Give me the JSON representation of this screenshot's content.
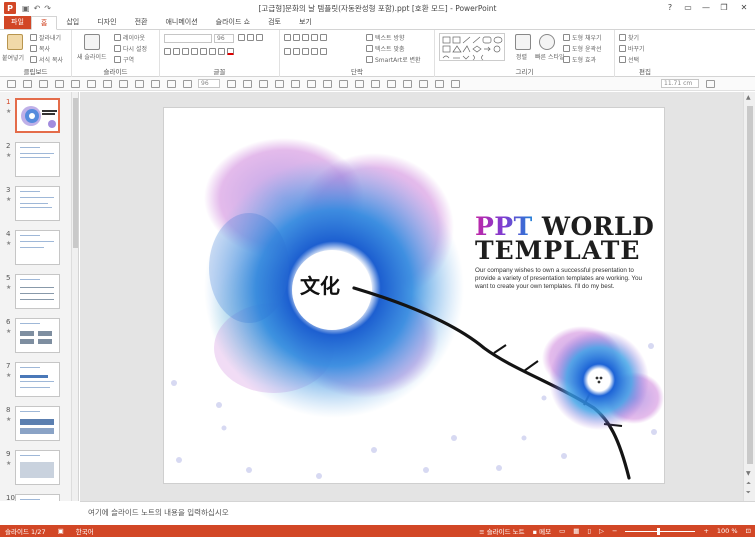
{
  "window": {
    "title": "[고급형]문화의 날 템플릿(자동완성형 포함).ppt [호환 모드] - PowerPoint",
    "app_icon_letter": "P",
    "controls": [
      "?",
      "▭",
      "—",
      "❐",
      "✕"
    ]
  },
  "tabs": [
    {
      "label": "파일"
    },
    {
      "label": "홈"
    },
    {
      "label": "삽입"
    },
    {
      "label": "디자인"
    },
    {
      "label": "전환"
    },
    {
      "label": "애니메이션"
    },
    {
      "label": "슬라이드 쇼"
    },
    {
      "label": "검토"
    },
    {
      "label": "보기"
    }
  ],
  "ribbon": {
    "clipboard": {
      "label": "클립보드",
      "paste": "붙여넣기",
      "cut": "잘라내기",
      "copy": "복사",
      "format_painter": "서식 복사"
    },
    "slides": {
      "label": "슬라이드",
      "new_slide": "새 슬라이드",
      "layout": "레이아웃",
      "reset": "다시 설정",
      "section": "구역"
    },
    "font": {
      "label": "글꼴",
      "size": "96"
    },
    "paragraph": {
      "label": "단락",
      "text_direction": "텍스트 방향",
      "align_text": "텍스트 맞춤",
      "smartart": "SmartArt로 변환"
    },
    "drawing": {
      "label": "그리기",
      "arrange": "정렬",
      "quick_styles": "빠른 스타일",
      "shape_fill": "도형 채우기",
      "shape_outline": "도형 윤곽선",
      "shape_effects": "도형 효과"
    },
    "editing": {
      "label": "편집",
      "find": "찾기",
      "replace": "바꾸기",
      "select": "선택"
    }
  },
  "quick_toolbar": {
    "font_size": "96",
    "measure": "11.71 cm"
  },
  "thumbnails": [
    {
      "num": "1",
      "star": "★",
      "active": true
    },
    {
      "num": "2",
      "star": "★"
    },
    {
      "num": "3",
      "star": "★"
    },
    {
      "num": "4",
      "star": "★"
    },
    {
      "num": "5",
      "star": "★"
    },
    {
      "num": "6",
      "star": "★"
    },
    {
      "num": "7",
      "star": "★"
    },
    {
      "num": "8",
      "star": "★"
    },
    {
      "num": "9",
      "star": "★"
    },
    {
      "num": "10",
      "star": "★"
    }
  ],
  "slide": {
    "title_ppt": "PPT",
    "title_world": " WORLD",
    "title_line2": "TEMPLATE",
    "body": "Our company wishes to own a successful presentation to provide a variety of presentation templates are working. You want to create your own templates. I'll do my best.",
    "culture_chars": "文化"
  },
  "notes": {
    "placeholder": "여기에 슬라이드 노트의 내용을 입력하십시오"
  },
  "status": {
    "slide_count": "슬라이드 1/27",
    "language": "한국어",
    "notes_btn": "슬라이드 노트",
    "comments_btn": "메모",
    "zoom": "100 %"
  },
  "colors": {
    "accent": "#d24726"
  }
}
